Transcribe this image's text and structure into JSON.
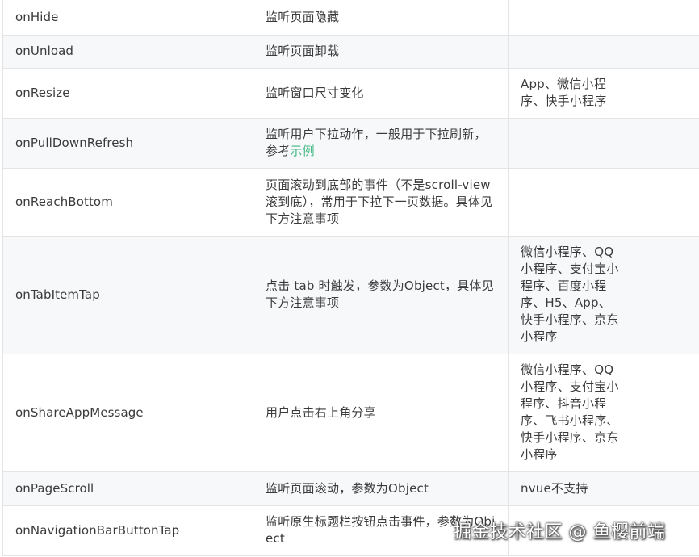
{
  "rows": [
    {
      "name": "onHide",
      "desc": "监听页面隐藏",
      "platform": ""
    },
    {
      "name": "onUnload",
      "desc": "监听页面卸载",
      "platform": ""
    },
    {
      "name": "onResize",
      "desc": "监听窗口尺寸变化",
      "platform": "App、微信小程序、快手小程序"
    },
    {
      "name": "onPullDownRefresh",
      "desc_before": "监听用户下拉动作，一般用于下拉刷新，参考",
      "desc_link": "示例",
      "platform": ""
    },
    {
      "name": "onReachBottom",
      "desc": "页面滚动到底部的事件（不是scroll-view滚到底），常用于下拉下一页数据。具体见下方注意事项",
      "platform": ""
    },
    {
      "name": "onTabItemTap",
      "desc": "点击 tab 时触发，参数为Object，具体见下方注意事项",
      "platform": "微信小程序、QQ小程序、支付宝小程序、百度小程序、H5、App、快手小程序、京东小程序"
    },
    {
      "name": "onShareAppMessage",
      "desc": "用户点击右上角分享",
      "platform": "微信小程序、QQ小程序、支付宝小程序、抖音小程序、飞书小程序、快手小程序、京东小程序"
    },
    {
      "name": "onPageScroll",
      "desc": "监听页面滚动，参数为Object",
      "platform": "nvue不支持"
    },
    {
      "name": "onNavigationBarButtonTap",
      "desc": "监听原生标题栏按钮点击事件，参数为Object",
      "platform": ""
    }
  ],
  "watermark": "掘金技术社区 @ 鱼樱前端",
  "colors": {
    "link": "#42b983",
    "row_alt_bg": "#f6f8fa",
    "border": "#e4e4e4"
  }
}
